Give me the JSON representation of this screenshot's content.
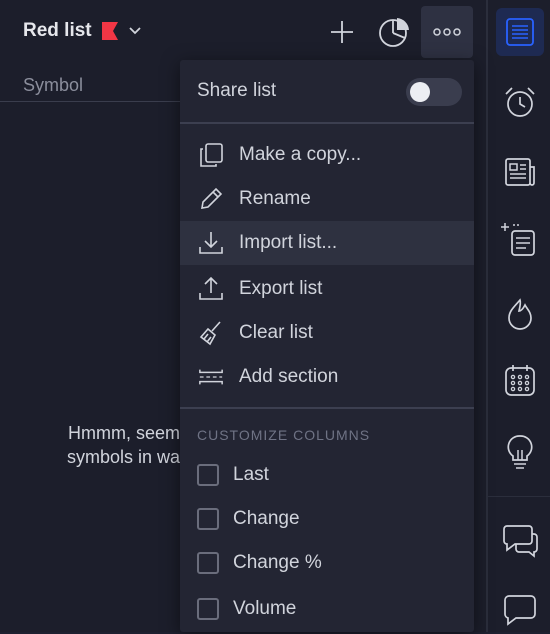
{
  "header": {
    "list_name": "Red list",
    "flag_color": "#f23645",
    "column_symbol": "Symbol"
  },
  "empty_state": {
    "line1": "Hmmm, seem",
    "line2": "symbols in wa"
  },
  "menu": {
    "share_label": "Share list",
    "share_enabled": false,
    "items": [
      {
        "label": "Make a copy...",
        "icon": "copy-icon"
      },
      {
        "label": "Rename",
        "icon": "pencil-icon"
      },
      {
        "label": "Import list...",
        "icon": "download-icon"
      },
      {
        "label": "Export list",
        "icon": "upload-icon"
      },
      {
        "label": "Clear list",
        "icon": "broom-icon"
      },
      {
        "label": "Add section",
        "icon": "section-icon"
      }
    ],
    "customize_title": "CUSTOMIZE COLUMNS",
    "columns": [
      {
        "label": "Last",
        "checked": false
      },
      {
        "label": "Change",
        "checked": false
      },
      {
        "label": "Change %",
        "checked": false
      },
      {
        "label": "Volume",
        "checked": false
      }
    ]
  },
  "rail": {
    "items": [
      "watchlist-icon",
      "alarm-clock-icon",
      "news-icon",
      "screener-icon",
      "hotlist-icon",
      "calendar-icon",
      "idea-bulb-icon",
      "chats-icon",
      "chat-icon"
    ],
    "accent": "#2962ff"
  }
}
